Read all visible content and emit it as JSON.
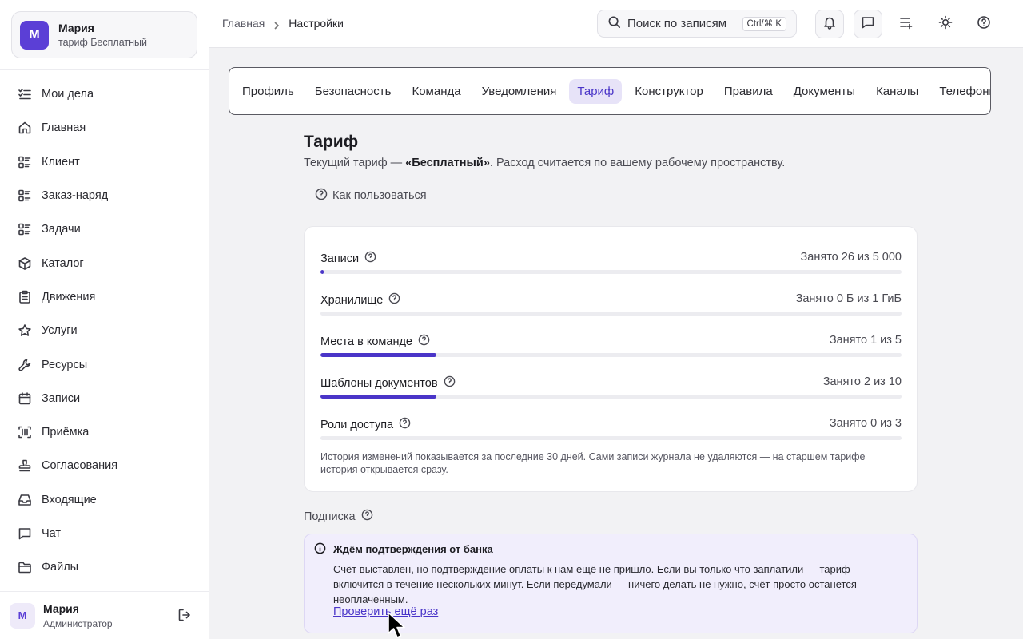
{
  "workspace": {
    "avatar": "М",
    "name": "Мария",
    "plan": "тариф Бесплатный"
  },
  "nav": [
    {
      "label": "Мои дела",
      "icon": "list-check-icon"
    },
    {
      "label": "Главная",
      "icon": "home-icon"
    },
    {
      "label": "Клиент",
      "icon": "list-icon"
    },
    {
      "label": "Заказ-наряд",
      "icon": "list-icon"
    },
    {
      "label": "Задачи",
      "icon": "list-icon"
    },
    {
      "label": "Каталог",
      "icon": "box-icon"
    },
    {
      "label": "Движения",
      "icon": "clipboard-icon"
    },
    {
      "label": "Услуги",
      "icon": "star-icon"
    },
    {
      "label": "Ресурсы",
      "icon": "wrench-icon"
    },
    {
      "label": "Записи",
      "icon": "calendar-icon"
    },
    {
      "label": "Приёмка",
      "icon": "scan-icon"
    },
    {
      "label": "Согласования",
      "icon": "stamp-icon"
    },
    {
      "label": "Входящие",
      "icon": "inbox-icon"
    },
    {
      "label": "Чат",
      "icon": "chat-icon"
    },
    {
      "label": "Файлы",
      "icon": "folder-icon"
    }
  ],
  "user": {
    "avatar": "М",
    "name": "Мария",
    "role": "Администратор"
  },
  "breadcrumb": {
    "home": "Главная",
    "current": "Настройки"
  },
  "search": {
    "placeholder": "Поиск по записям",
    "shortcut": "Ctrl/⌘ K"
  },
  "tabs": [
    {
      "label": "Профиль",
      "active": false
    },
    {
      "label": "Безопасность",
      "active": false
    },
    {
      "label": "Команда",
      "active": false
    },
    {
      "label": "Уведомления",
      "active": false
    },
    {
      "label": "Тариф",
      "active": true
    },
    {
      "label": "Конструктор",
      "active": false
    },
    {
      "label": "Правила",
      "active": false
    },
    {
      "label": "Документы",
      "active": false
    },
    {
      "label": "Каналы",
      "active": false
    },
    {
      "label": "Телефония",
      "active": false
    }
  ],
  "page": {
    "title": "Тариф",
    "subtitle_pre": "Текущий тариф — ",
    "subtitle_plan": "«Бесплатный»",
    "subtitle_post": ". Расход считается по вашему рабочему пространству.",
    "howto": "Как пользоваться"
  },
  "usage": [
    {
      "label": "Записи",
      "value": "Занято 26 из 5 000",
      "fraction": 0.0052
    },
    {
      "label": "Хранилище",
      "value": "Занято 0 Б из 1 ГиБ",
      "fraction": 0
    },
    {
      "label": "Места в команде",
      "value": "Занято 1 из 5",
      "fraction": 0.2
    },
    {
      "label": "Шаблоны документов",
      "value": "Занято 2 из 10",
      "fraction": 0.2
    },
    {
      "label": "Роли доступа",
      "value": "Занято 0 из 3",
      "fraction": 0
    }
  ],
  "usage_note": "История изменений показывается за последние 30 дней. Сами записи журнала не удаляются — на старшем тарифе история открывается сразу.",
  "subscription": {
    "label": "Подписка",
    "alert_title": "Ждём подтверждения от банка",
    "alert_body": "Счёт выставлен, но подтверждение оплаты к нам ещё не пришло. Если вы только что заплатили — тариф включится в течение нескольких минут. Если передумали — ничего делать не нужно, счёт просто останется неоплаченным.",
    "alert_link": "Проверить ещё раз"
  },
  "colors": {
    "accent": "#4a35c8",
    "accent_soft": "#e7e3f8",
    "alert_bg": "#f1eefc"
  }
}
